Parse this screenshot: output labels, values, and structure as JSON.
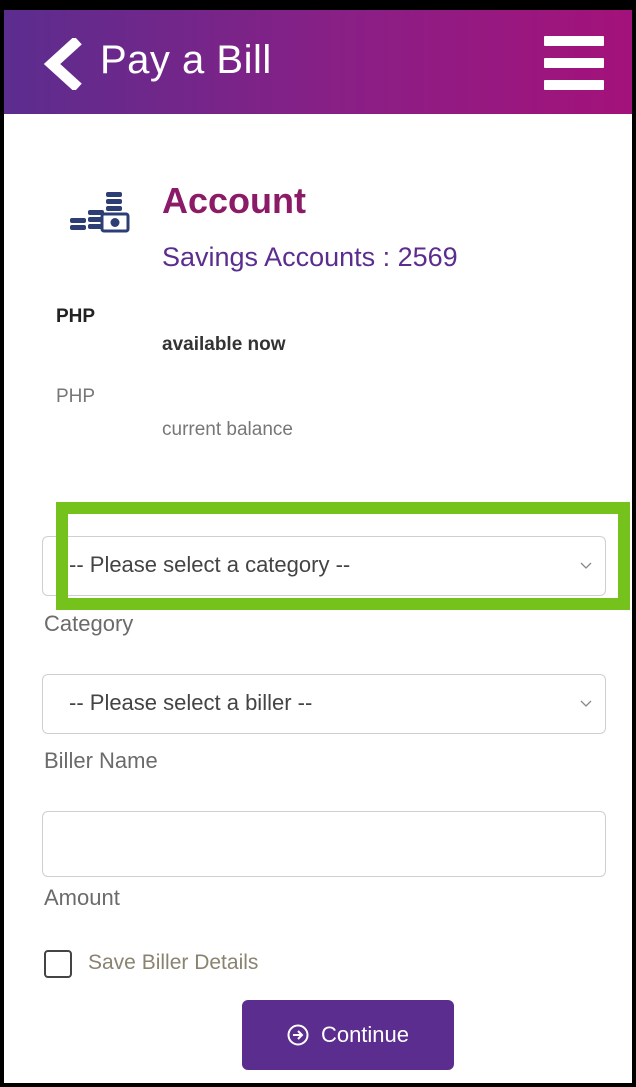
{
  "header": {
    "title": "Pay a Bill"
  },
  "account": {
    "heading": "Account",
    "subtitle": "Savings Accounts : 2569",
    "available": {
      "currency": "PHP",
      "label": "available now"
    },
    "current": {
      "currency": "PHP",
      "label": "current balance"
    }
  },
  "form": {
    "category": {
      "selected": "-- Please select a category --",
      "label": "Category"
    },
    "biller": {
      "selected": "-- Please select a biller --",
      "label": "Biller Name"
    },
    "amount": {
      "value": "",
      "label": "Amount"
    },
    "save_biller_label": "Save Biller Details",
    "save_biller_checked": false,
    "continue_label": "Continue"
  },
  "colors": {
    "header_start": "#5b2d8e",
    "header_end": "#a3127a",
    "accent_purple": "#5b2d8e",
    "heading_magenta": "#8b1a67",
    "highlight_green": "#76c21d"
  },
  "icons": {
    "back": "chevron-left-icon",
    "menu": "hamburger-menu-icon",
    "account": "coins-stack-icon",
    "dropdown": "chevron-down-icon",
    "continue": "arrow-circle-right-icon"
  }
}
